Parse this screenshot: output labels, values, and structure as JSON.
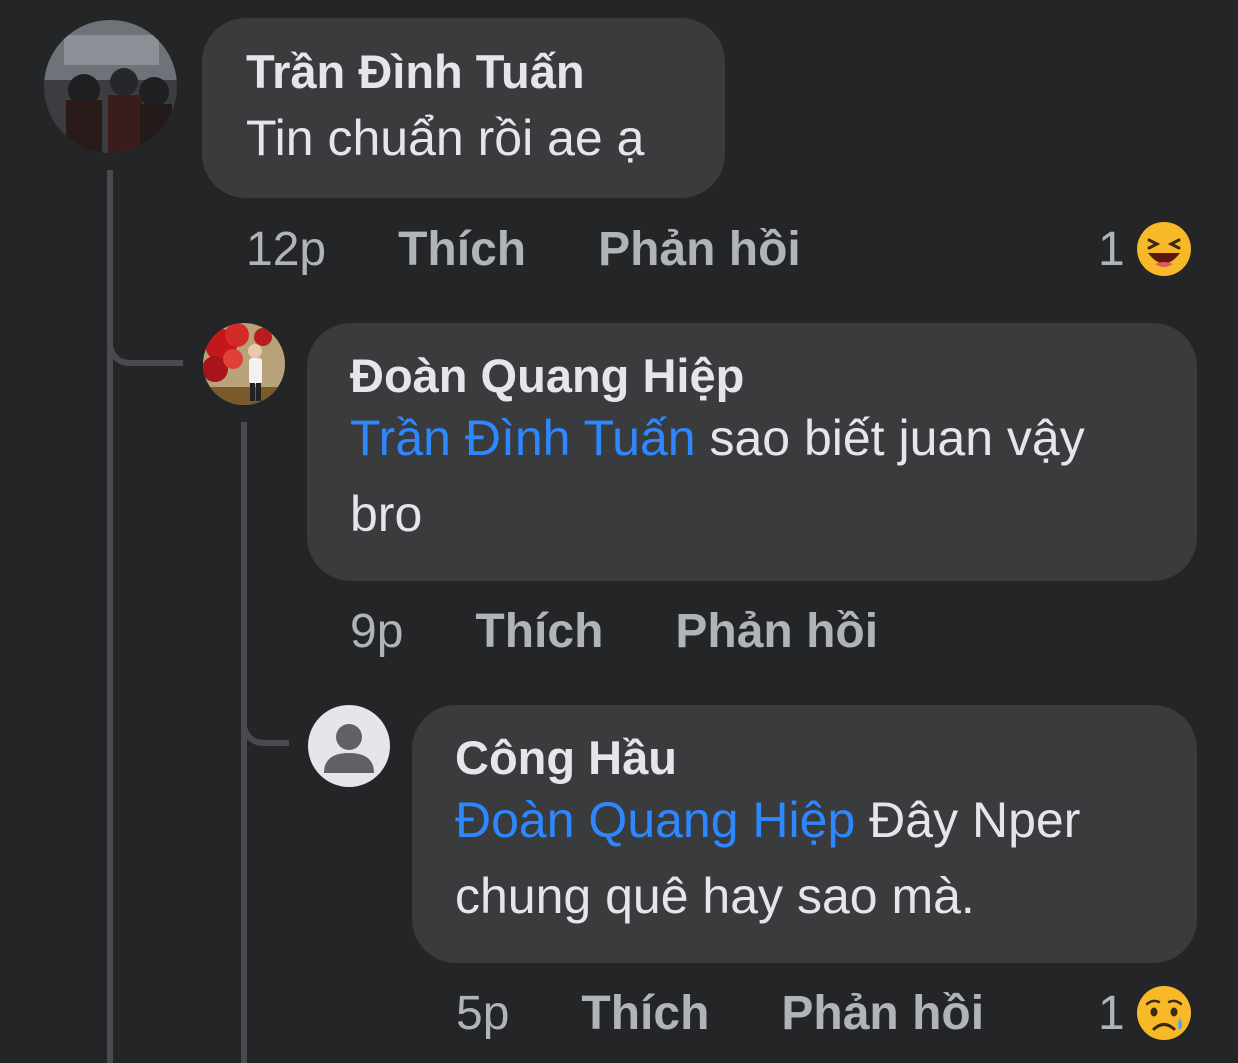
{
  "comments": [
    {
      "author": "Trần Đình Tuấn",
      "text": "Tin chuẩn rồi ae ạ",
      "time": "12p",
      "like_label": "Thích",
      "reply_label": "Phản hồi",
      "reaction_count": "1",
      "reaction_icon": "laughing-emoji-icon"
    },
    {
      "author": "Đoàn Quang Hiệp",
      "mention": "Trần Đình Tuấn",
      "text_line1": " sao biết juan vậy",
      "text_line2": "bro",
      "time": "9p",
      "like_label": "Thích",
      "reply_label": "Phản hồi"
    },
    {
      "author": "Công Hầu",
      "mention": "Đoàn Quang Hiệp",
      "text_line1": " Đây Nper",
      "text_line2": "chung quê hay sao mà.",
      "time": "5p",
      "like_label": "Thích",
      "reply_label": "Phản hồi",
      "reaction_count": "1",
      "reaction_icon": "crying-emoji-icon"
    }
  ],
  "colors": {
    "background": "#242527",
    "bubble": "#3a3b3c",
    "mention": "#2d88ff",
    "secondary_text": "#b0b3b8"
  }
}
